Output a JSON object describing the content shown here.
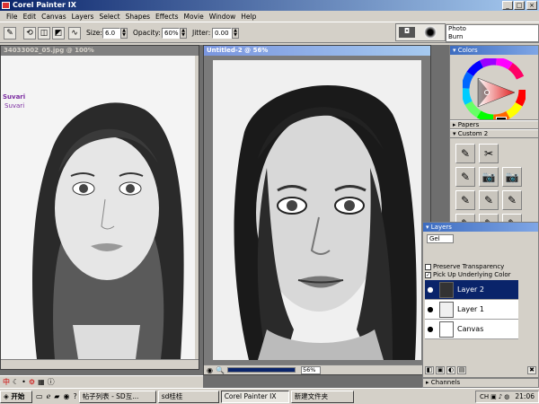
{
  "app": {
    "title": "Corel Painter IX"
  },
  "menu": [
    "File",
    "Edit",
    "Canvas",
    "Layers",
    "Select",
    "Shapes",
    "Effects",
    "Movie",
    "Window",
    "Help"
  ],
  "property_bar": {
    "size_label": "Size:",
    "size_value": "6.0",
    "opacity_label": "Opacity:",
    "opacity_value": "60%",
    "jitter_label": "Jitter:",
    "jitter_value": "0.00"
  },
  "brush_variants": [
    "Photo",
    "Burn"
  ],
  "doc_left": {
    "title": "34033002_05.jpg @ 100%",
    "watermark_1": "Suvari",
    "watermark_2": "Suvari"
  },
  "doc_right": {
    "title": "Untitled-2 @ 56%",
    "zoom": "56%"
  },
  "colors_panel": {
    "title": "Colors"
  },
  "papers_panel": {
    "title": "Papers"
  },
  "custom_panel": {
    "title": "Custom 2",
    "tools": [
      "✎",
      "✂",
      "✎",
      "📷",
      "📷",
      "✎",
      "✎",
      "✎",
      "✎",
      "✎",
      "✎"
    ]
  },
  "layers_panel": {
    "title": "Layers",
    "composite": "Gel",
    "preserve": "Preserve Transparency",
    "pickup": "Pick Up Underlying Color",
    "layers": [
      "Layer 2",
      "Layer 1",
      "Canvas"
    ]
  },
  "channels_panel": {
    "title": "Channels"
  },
  "taskbar": {
    "start": "开始",
    "items": [
      "帖子列表 - SD互...",
      "sd桂桂",
      "Corel Painter IX",
      "新建文件夹"
    ],
    "time": "21:06"
  }
}
